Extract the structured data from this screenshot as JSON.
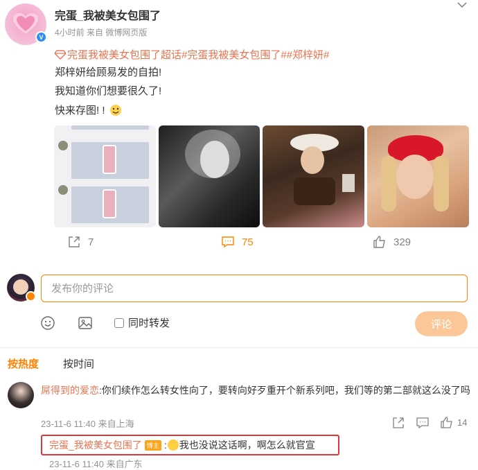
{
  "post": {
    "author": "完蛋_我被美女包围了",
    "time": "4小时前",
    "source": "来自 微博网页版",
    "topics": "完蛋我被美女包围了超话#完蛋我被美女包围了##郑梓妍#",
    "lines": [
      "郑梓妍给顾易发的自拍!",
      "我知道你们想要很久了!",
      "快来存图! !"
    ],
    "actions": {
      "repost_count": "7",
      "comment_count": "75",
      "like_count": "329"
    }
  },
  "composer": {
    "placeholder": "发布你的评论",
    "repost_label": "同时转发",
    "send_label": "评论"
  },
  "sort": {
    "hot": "按热度",
    "time": "按时间"
  },
  "comments": [
    {
      "user": "屌得到的爱恋",
      "text": ":你们续作怎么转女性向了，要转向好歹重开个新系列吧，我们等的第二部就这么没了吗",
      "meta": "23-11-6 11:40 来自上海",
      "likes": "14",
      "reply": {
        "user": "完蛋_我被美女包围了",
        "badge": "博主",
        "text": "我也没说这话啊，啊怎么就官宣",
        "meta": "23-11-6 11:40 来自广东"
      }
    }
  ],
  "colors": {
    "accent": "#ff8200",
    "link": "#eb7350",
    "highlight": "#e0353a"
  }
}
